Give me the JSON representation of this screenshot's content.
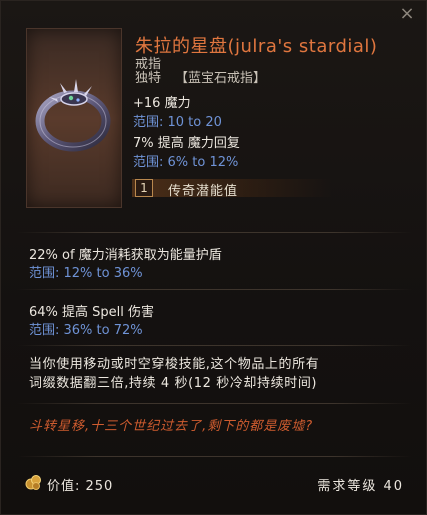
{
  "item": {
    "title": "朱拉的星盘(julra's stardial)",
    "subtype": "戒指",
    "rarity": "独特",
    "gem_type": "【蓝宝石戒指】"
  },
  "header_stats": [
    {
      "text": "+16 魔力",
      "range": "范围: 10 to 20"
    },
    {
      "text": "7% 提高 魔力回复",
      "range": "范围: 6% to 12%"
    }
  ],
  "potential": {
    "count": "1",
    "label": "传奇潜能值"
  },
  "affixes": [
    {
      "text": "22% of 魔力消耗获取为能量护盾",
      "range": "范围: 12% to 36%"
    },
    {
      "text": "64% 提高 Spell 伤害",
      "range": "范围: 36% to 72%"
    }
  ],
  "unique_effect": [
    "当你使用移动或时空穿梭技能,这个物品上的所有",
    "词缀数据翻三倍,持续 4 秒(12 秒冷却持续时间)"
  ],
  "flavor_text": "斗转星移,十三个世纪过去了,剩下的都是废墟?",
  "footer": {
    "value": "价值: 250",
    "level_req": "需求等级 40"
  },
  "icons": {
    "close": "close-icon",
    "ring": "ring-item-icon",
    "coin": "gold-coin-icon"
  },
  "colors": {
    "title": "#e0763f",
    "range": "#6f93d6",
    "flavor": "#cf5c2f"
  }
}
